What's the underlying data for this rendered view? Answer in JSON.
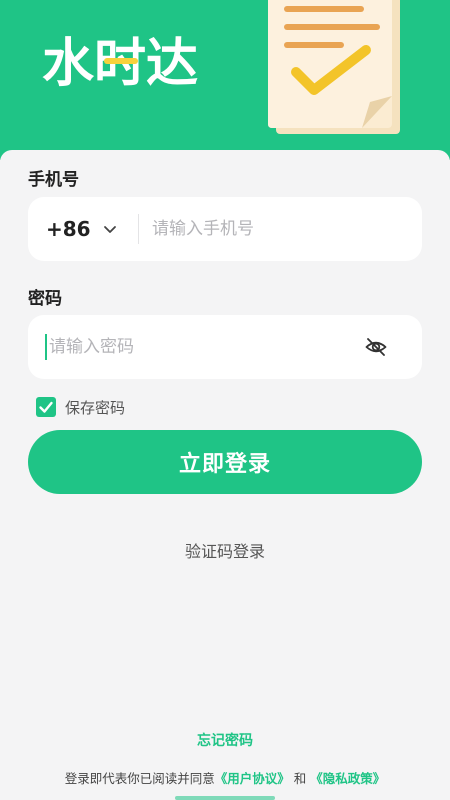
{
  "header": {
    "logo_text": "水时达",
    "brand_color": "#1fc486",
    "accent_color": "#f7d23c"
  },
  "phone": {
    "label": "手机号",
    "country_code": "+86",
    "placeholder": "请输入手机号",
    "value": ""
  },
  "password": {
    "label": "密码",
    "placeholder": "请输入密码",
    "value": "",
    "visibility_icon": "eye-off-icon"
  },
  "remember": {
    "label": "保存密码",
    "checked": true
  },
  "login_button": {
    "label": "立即登录"
  },
  "sms_login": {
    "label": "验证码登录"
  },
  "footer": {
    "forgot_password": "忘记密码",
    "agreement_prefix": "登录即代表你已阅读并同意",
    "user_agreement": "《用户协议》",
    "conjunction": "和",
    "privacy_policy": "《隐私政策》"
  }
}
